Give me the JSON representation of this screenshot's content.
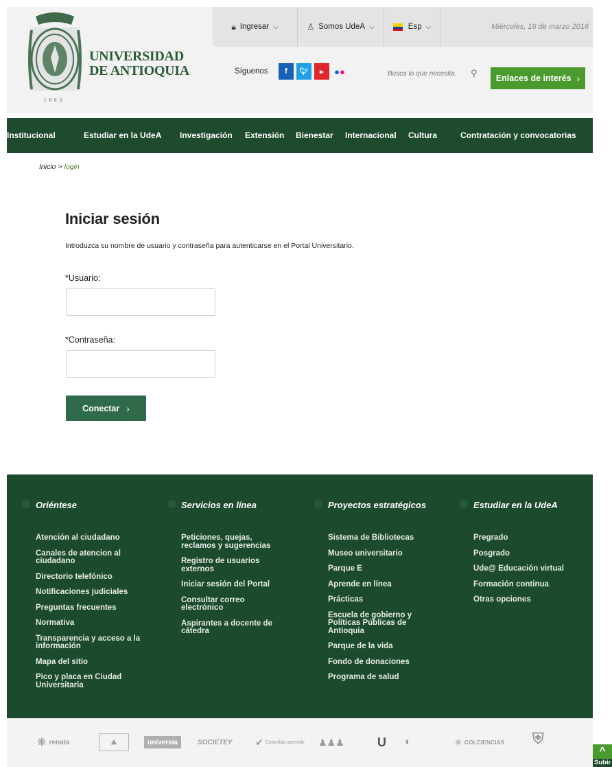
{
  "brand": {
    "line1": "UNIVERSIDAD",
    "line2": "DE ANTIOQUIA",
    "year": "1803",
    "green": "#1e4a2d",
    "accent": "#4a9a2e"
  },
  "topbar": {
    "login_label": "Ingresar",
    "somos_label": "Somos UdeA",
    "lang_label": "Esp",
    "date": "Miércoles, 16 de marzo 2016"
  },
  "social": {
    "follow_label": "Síguenos",
    "items": [
      {
        "icon": "facebook-icon",
        "glyph": "f",
        "color": "#1a61b5"
      },
      {
        "icon": "twitter-icon",
        "glyph": "t",
        "color": "#1e9fe6"
      },
      {
        "icon": "youtube-icon",
        "glyph": "▶",
        "color": "#e0262e"
      },
      {
        "icon": "flickr-icon",
        "glyph": "••",
        "color": "#f2f2f2"
      }
    ]
  },
  "search": {
    "placeholder": "Busca lo que necesita."
  },
  "links_button": "Enlaces de interés",
  "nav": [
    "Institucional",
    "Estudiar en la UdeA",
    "Investigación",
    "Extensión",
    "Bienestar",
    "Internacional",
    "Cultura",
    "Contratación y convocatorias"
  ],
  "breadcrumb": {
    "home": "Inicio",
    "sep": " > ",
    "current": "login"
  },
  "login": {
    "title": "Iniciar sesión",
    "description": "Introduzca su nombre de usuario y contraseña para autenticarse en el Portal Universitario.",
    "user_label": "*Usuario:",
    "password_label": "*Contraseña:",
    "submit_label": "Conectar"
  },
  "footer": {
    "columns": [
      {
        "heading": "Oriéntese",
        "items": [
          "Atención al ciudadano",
          "Canales de atencion al\nciudadano",
          "Directorio telefónico",
          "Notificaciones judiciales",
          "Preguntas frecuentes",
          "Normativa",
          "Transparencia y acceso a la\ninformación",
          "Mapa del sitio",
          "Pico y placa en Ciudad\nUniversitaria"
        ]
      },
      {
        "heading": "Servicios en línea",
        "items": [
          "Peticiones, quejas,\nreclamos y sugerencias",
          "Registro de usuarios\nexternos",
          "Iniciar sesión del Portal",
          "Consultar correo\nelectrónico",
          "Aspirantes a docente de\ncátedra"
        ]
      },
      {
        "heading": "Proyectos estratégicos",
        "items": [
          "Sistema de Bibliotecas",
          "Museo universitario",
          "Parque E",
          "Aprende en línea",
          "Prácticas",
          "Escuela de gobierno y\nPolíticas Públicas de\nAntioquia",
          "Parque de la vida",
          "Fondo de donaciones",
          "Programa de salud"
        ]
      },
      {
        "heading": "Estudiar en la UdeA",
        "items": [
          "Pregrado",
          "Posgrado",
          "Ude@ Educación virtual",
          "Formación continua",
          "Otras opciones"
        ]
      }
    ]
  },
  "partners": [
    {
      "name": "renata",
      "icon": "renata-logo"
    },
    {
      "name": "",
      "icon": "red-logo"
    },
    {
      "name": "universia",
      "icon": "universia-logo"
    },
    {
      "name": "SOCIETEY",
      "icon": "societey-logo"
    },
    {
      "name": "Colombia aprende",
      "icon": "colombia-aprende-logo"
    },
    {
      "name": "",
      "icon": "talento-logo"
    },
    {
      "name": "",
      "icon": "u-logo"
    },
    {
      "name": "",
      "icon": "corporacion-logo"
    },
    {
      "name": "COLCIENCIAS",
      "icon": "colciencias-logo"
    },
    {
      "name": "",
      "icon": "acreditacion-logo"
    }
  ],
  "to_top": {
    "label": "Subir"
  }
}
